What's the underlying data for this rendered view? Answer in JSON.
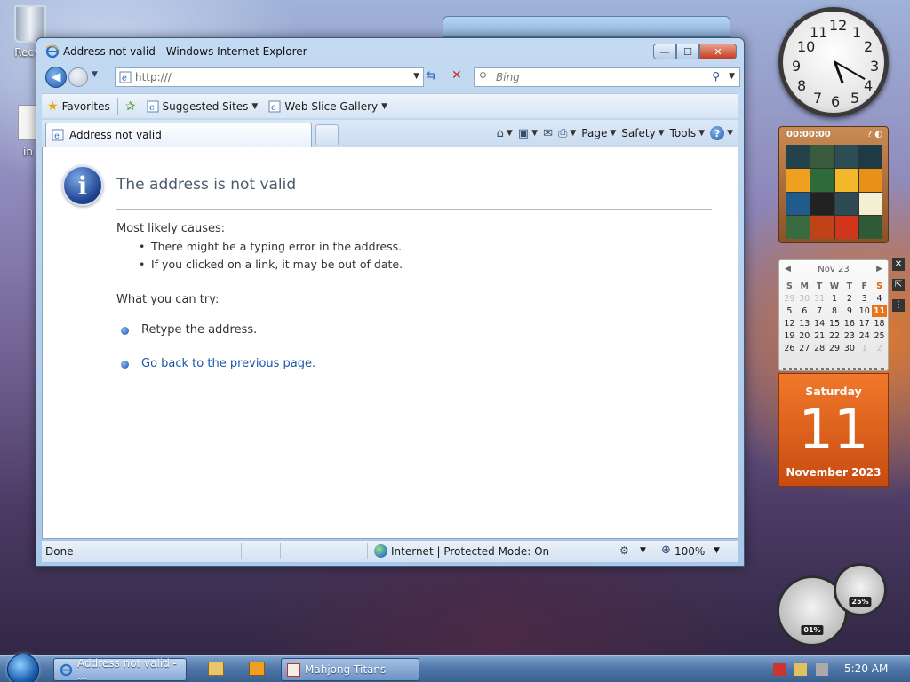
{
  "desktop": {
    "recycle_bin_label": "Recyc",
    "file_label": "in"
  },
  "window": {
    "title": "Address not valid - Windows Internet Explorer",
    "minimize": "—",
    "maximize": "☐",
    "close": "✕"
  },
  "navbar": {
    "address_value": "http:///",
    "search_placeholder": "Bing"
  },
  "favorites_bar": {
    "favorites_label": "Favorites",
    "suggested_sites_label": "Suggested Sites",
    "web_slice_gallery_label": "Web Slice Gallery"
  },
  "tabs": {
    "active_tab_label": "Address not valid"
  },
  "command_bar": {
    "page_label": "Page",
    "safety_label": "Safety",
    "tools_label": "Tools",
    "help_label": "?"
  },
  "page": {
    "heading": "The address is not valid",
    "causes_title": "Most likely causes:",
    "causes": [
      "There might be a typing error in the address.",
      "If you clicked on a link, it may be out of date."
    ],
    "try_title": "What you can try:",
    "try_items": [
      "Retype the address.",
      "Go back to the previous page."
    ]
  },
  "statusbar": {
    "status": "Done",
    "zone": "Internet | Protected Mode: On",
    "zoom": "100%"
  },
  "gadgets": {
    "clock_numbers": [
      "12",
      "1",
      "2",
      "3",
      "4",
      "5",
      "6",
      "7",
      "8",
      "9",
      "10",
      "11"
    ],
    "puzzle_timer": "00:00:00",
    "calendar": {
      "month_label": "Nov 23",
      "weekdays": [
        "S",
        "M",
        "T",
        "W",
        "T",
        "F",
        "S"
      ],
      "days": [
        [
          "29",
          "30",
          "31",
          "1",
          "2",
          "3",
          "4"
        ],
        [
          "5",
          "6",
          "7",
          "8",
          "9",
          "10",
          "11"
        ],
        [
          "12",
          "13",
          "14",
          "15",
          "16",
          "17",
          "18"
        ],
        [
          "19",
          "20",
          "21",
          "22",
          "23",
          "24",
          "25"
        ],
        [
          "26",
          "27",
          "28",
          "29",
          "30",
          "1",
          "2"
        ]
      ],
      "today": "11"
    },
    "day_card": {
      "weekday": "Saturday",
      "day": "11",
      "month_year": "November 2023"
    },
    "cpu_value": "01%",
    "memory_value": "25%"
  },
  "taskbar": {
    "ie_button": "Address not valid - ...",
    "mahjong_button": "Mahjong Titans",
    "time": "5:20 AM"
  },
  "colors": {
    "accent_orange": "#e8731a",
    "link_blue": "#1a57a8",
    "heading_gray": "#4b5a6b"
  }
}
